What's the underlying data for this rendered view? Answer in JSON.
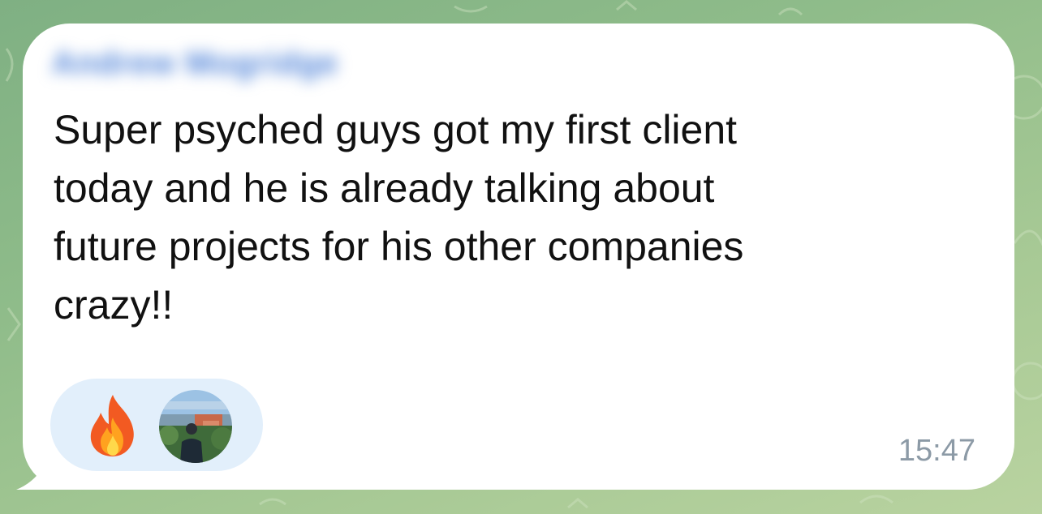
{
  "message": {
    "sender_name": "Andrew Mogridge",
    "text": "Super psyched guys got my first client\ntoday and he is already talking about\nfuture projects for his other companies\ncrazy!!",
    "timestamp": "15:47"
  },
  "reactions": [
    {
      "type": "emoji",
      "icon": "fire-icon"
    },
    {
      "type": "avatar",
      "icon": "user-avatar"
    }
  ],
  "colors": {
    "bubble": "#ffffff",
    "reaction_pill": "#e2effb",
    "sender_name": "#4e82d8",
    "timestamp": "#8c9aa6",
    "background": "#8fbc8a"
  }
}
